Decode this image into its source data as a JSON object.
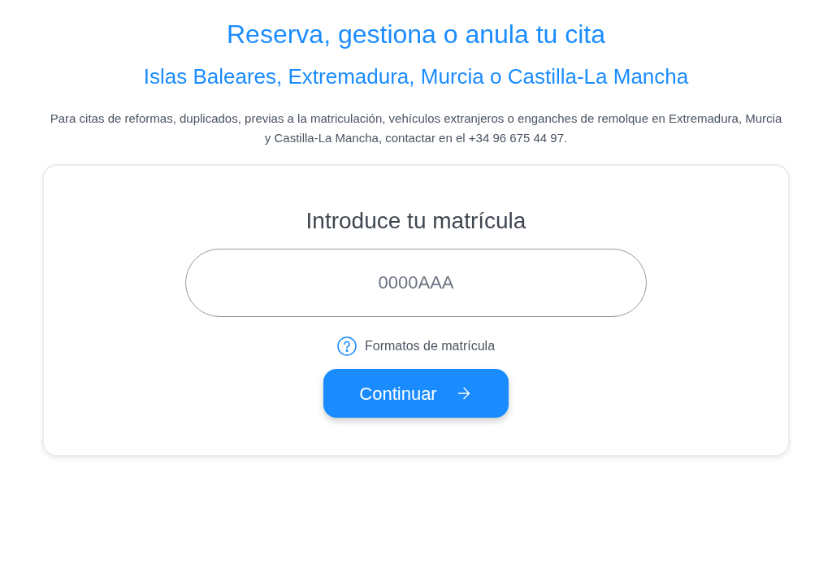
{
  "title": "Reserva, gestiona o anula tu cita",
  "subtitle": "Islas Baleares, Extremadura, Murcia o Castilla-La Mancha",
  "notice": "Para citas de reformas, duplicados, previas a la matriculación, vehículos extranjeros o enganches de remolque en Extremadura, Murcia y Castilla-La Mancha, contactar en el +34 96 675 44 97.",
  "card": {
    "heading": "Introduce tu matrícula",
    "plate_field": {
      "placeholder": "0000AAA"
    },
    "help_link": "Formatos de matrícula",
    "button": "Continuar"
  }
}
